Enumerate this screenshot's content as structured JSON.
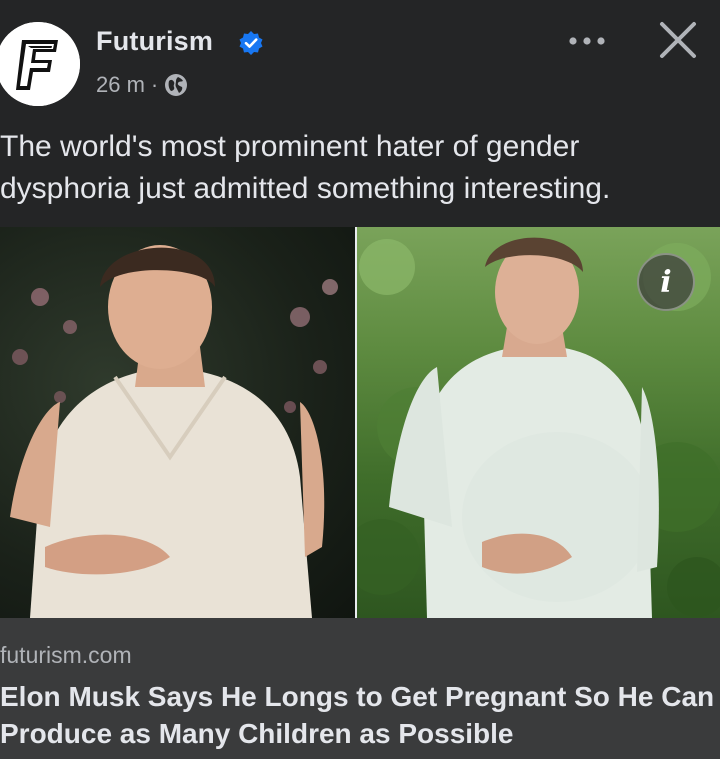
{
  "post": {
    "page_name": "Futurism",
    "timestamp": "26 m",
    "separator": "·",
    "avatar_letter": "F",
    "caption": "The world's most prominent hater of gender dysphoria just admitted something interesting.",
    "icons": {
      "verified": "verified-badge-icon",
      "audience": "globe-icon",
      "more": "more-options-icon",
      "close": "close-icon",
      "info": "info-icon"
    },
    "info_glyph": "i",
    "link": {
      "domain": "futurism.com",
      "headline": "Elon Musk Says He Longs to Get Pregnant So He Can Produce as Many Children as Possible"
    },
    "colors": {
      "background": "#242526",
      "link_preview_bg": "#3a3b3c",
      "primary_text": "#e4e6eb",
      "secondary_text": "#b0b3b8",
      "verified_blue": "#1877f2"
    }
  }
}
